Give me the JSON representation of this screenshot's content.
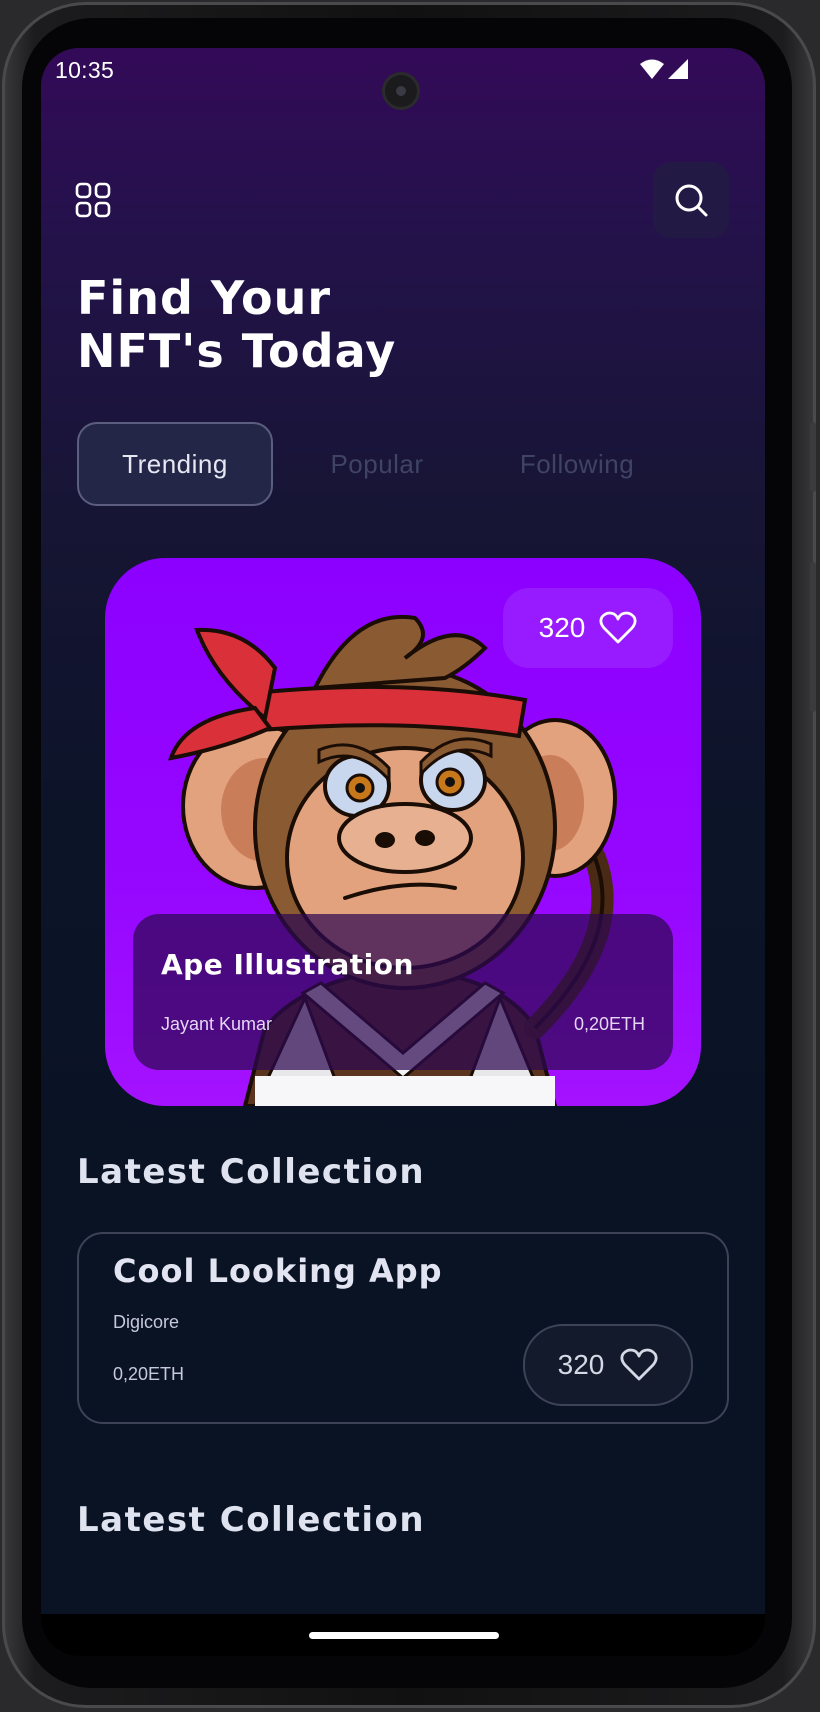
{
  "status_bar": {
    "time": "10:35"
  },
  "header": {
    "menu_icon": "grid-icon",
    "search_icon": "search-icon"
  },
  "headline": {
    "line1": "Find Your",
    "line2": "NFT's Today"
  },
  "tabs": [
    {
      "label": "Trending",
      "active": true
    },
    {
      "label": "Popular",
      "active": false
    },
    {
      "label": "Following",
      "active": false
    }
  ],
  "featured": {
    "likes": "320",
    "title": "Ape Illustration",
    "author": "Jayant Kumar",
    "price": "0,20ETH",
    "image": "cartoon-monkey-with-red-headband",
    "background_color": "#9100ff"
  },
  "sections": [
    {
      "title": "Latest Collection",
      "items": [
        {
          "title": "Cool Looking App",
          "creator": "Digicore",
          "price": "0,20ETH",
          "likes": "320"
        }
      ]
    },
    {
      "title": "Latest Collection"
    }
  ]
}
